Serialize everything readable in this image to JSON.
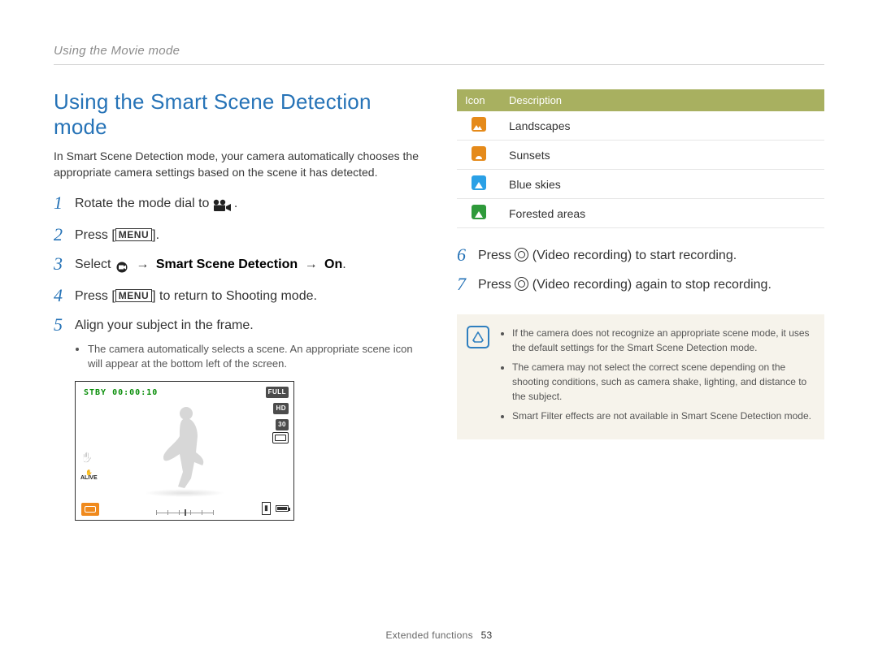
{
  "breadcrumb": "Using the Movie mode",
  "title": "Using the Smart Scene Detection mode",
  "intro": "In Smart Scene Detection mode, your camera automatically chooses the appropriate camera settings based on the scene it has detected.",
  "steps_left": {
    "s1_a": "Rotate the mode dial to ",
    "s1_b": ".",
    "s2_a": "Press [",
    "s2_b": "].",
    "s3_a": "Select ",
    "s3_bold": "Smart Scene Detection",
    "s3_bold2": "On",
    "s3_end": ".",
    "s4_a": "Press [",
    "s4_b": "] to return to Shooting mode.",
    "s5": "Align your subject in the frame.",
    "s5_sub": "The camera automatically selects a scene. An appropriate scene icon will appear at the bottom left of the screen."
  },
  "menu_label": "MENU",
  "arrow": "→",
  "preview": {
    "stby": "STBY 00:00:10",
    "tag_full": "FULL",
    "tag_hd": "HD",
    "tag_30": "30",
    "alive": "ALIVE"
  },
  "table": {
    "head_icon": "Icon",
    "head_desc": "Description",
    "rows": [
      {
        "icon": "landscape",
        "desc": "Landscapes"
      },
      {
        "icon": "sunset",
        "desc": "Sunsets"
      },
      {
        "icon": "blue-sky",
        "desc": "Blue skies"
      },
      {
        "icon": "forest",
        "desc": "Forested areas"
      }
    ]
  },
  "steps_right": {
    "s6_a": "Press ",
    "s6_b": " (Video recording) to start recording.",
    "s7_a": "Press ",
    "s7_b": " (Video recording) again to stop recording."
  },
  "notes": {
    "n1": "If the camera does not recognize an appropriate scene mode, it uses the default settings for the Smart Scene Detection mode.",
    "n2": "The camera may not select the correct scene depending on the shooting conditions, such as camera shake, lighting, and distance to the subject.",
    "n3": "Smart Filter effects are not available in Smart Scene Detection mode."
  },
  "footer": {
    "section": "Extended functions",
    "page": "53"
  }
}
